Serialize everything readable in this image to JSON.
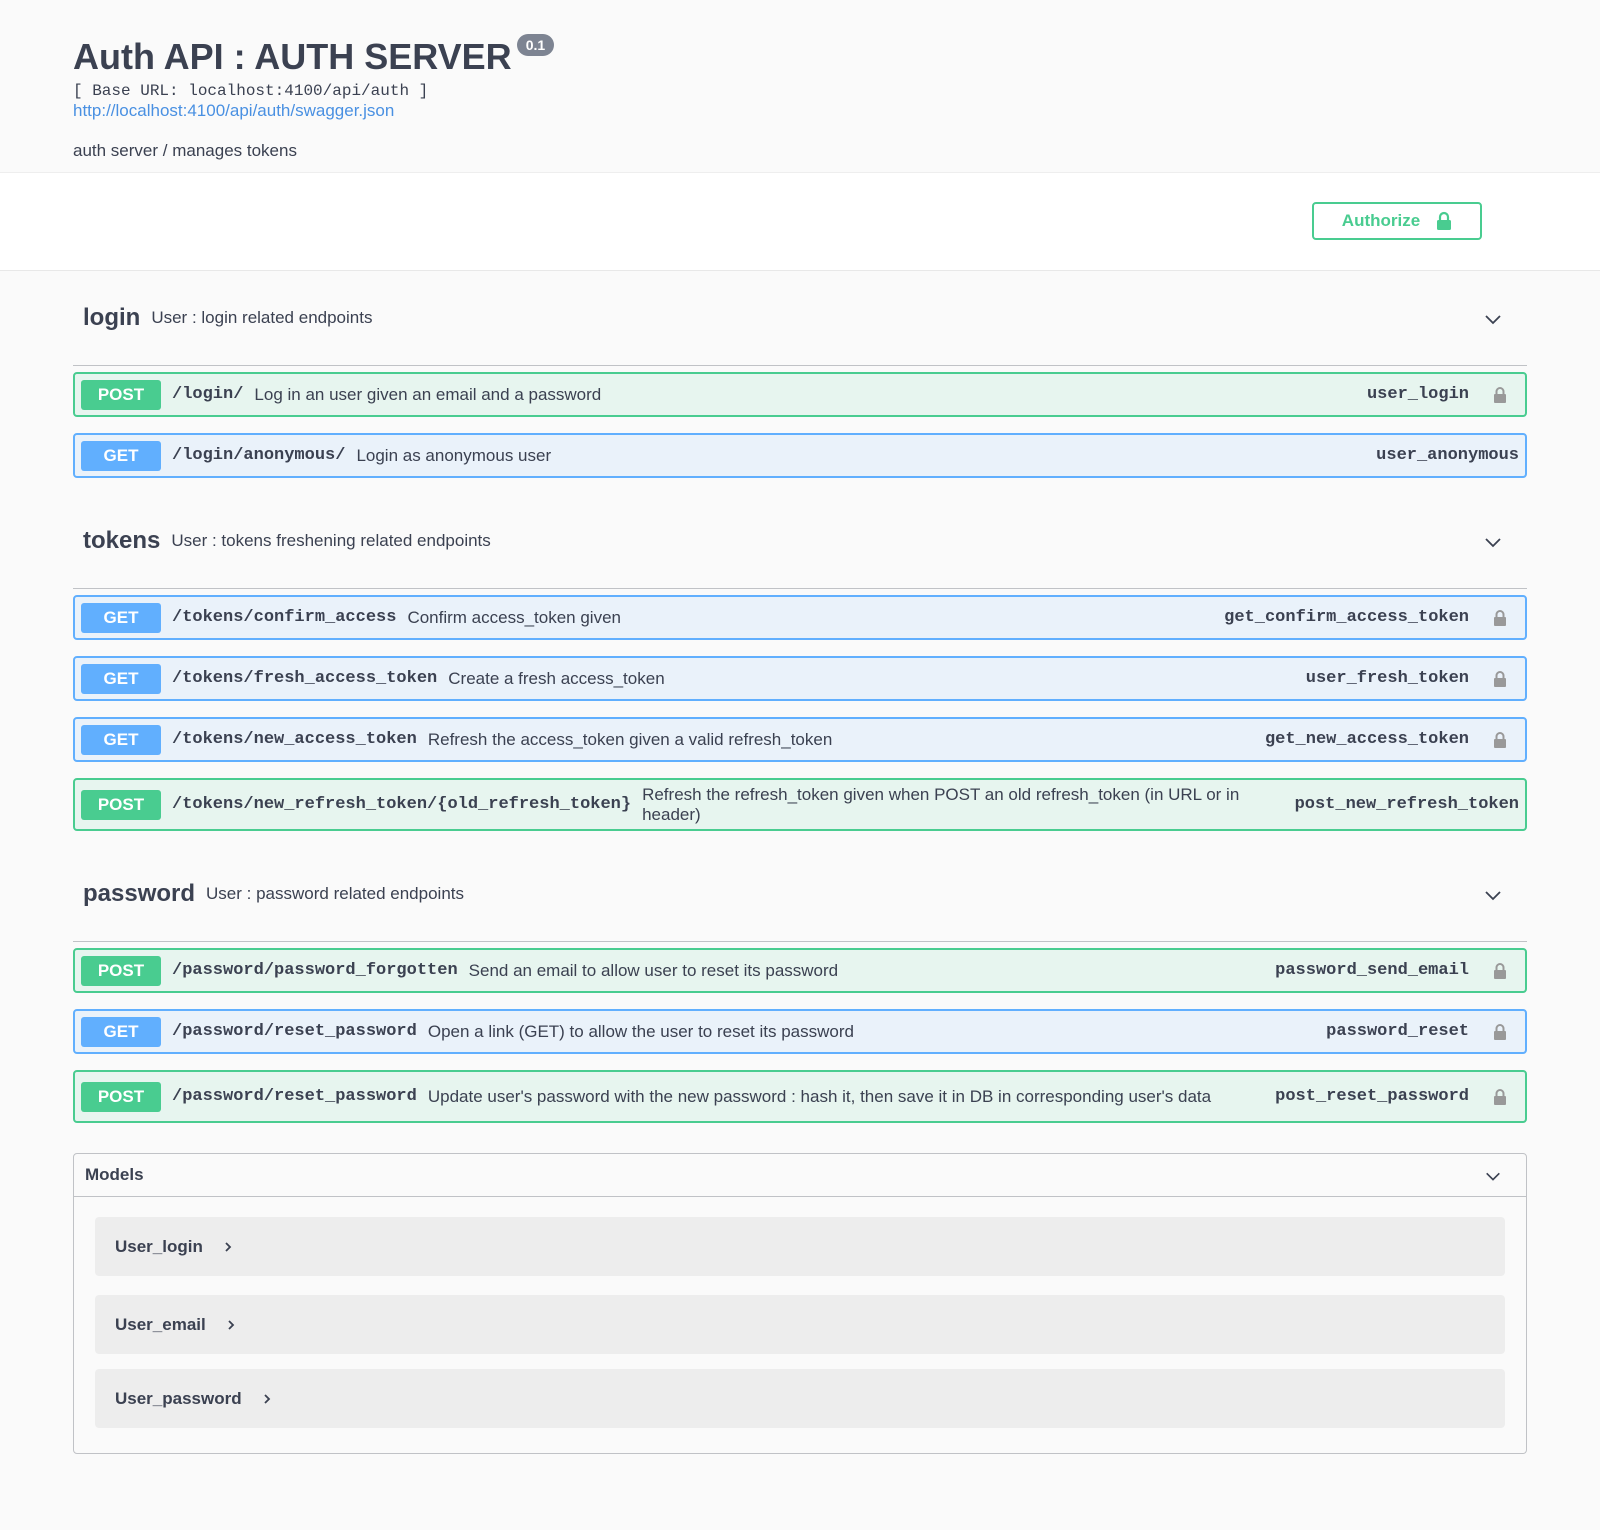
{
  "info": {
    "title": "Auth API : AUTH SERVER",
    "version": "0.1",
    "base_url": "[ Base URL: localhost:4100/api/auth ]",
    "spec_link": "http://localhost:4100/api/auth/swagger.json",
    "description": "auth server / manages tokens"
  },
  "authorize": {
    "label": "Authorize"
  },
  "tags": [
    {
      "name": "login",
      "description": "User : login related endpoints",
      "operations": [
        {
          "method": "POST",
          "path": "/login/",
          "summary": "Log in an user given an email and a password",
          "operation_id": "user_login",
          "locked": true
        },
        {
          "method": "GET",
          "path": "/login/anonymous/",
          "summary": "Login as anonymous user",
          "operation_id": "user_anonymous",
          "locked": false
        }
      ]
    },
    {
      "name": "tokens",
      "description": "User : tokens freshening related endpoints",
      "operations": [
        {
          "method": "GET",
          "path": "/tokens/confirm_access",
          "summary": "Confirm access_token given",
          "operation_id": "get_confirm_access_token",
          "locked": true
        },
        {
          "method": "GET",
          "path": "/tokens/fresh_access_token",
          "summary": "Create a fresh access_token",
          "operation_id": "user_fresh_token",
          "locked": true
        },
        {
          "method": "GET",
          "path": "/tokens/new_access_token",
          "summary": "Refresh the access_token given a valid refresh_token",
          "operation_id": "get_new_access_token",
          "locked": true
        },
        {
          "method": "POST",
          "path": "/tokens/new_refresh_token/{old_refresh_token}",
          "summary": "Refresh the refresh_token given when POST an old refresh_token (in URL or in header)",
          "operation_id": "post_new_refresh_token",
          "locked": false
        }
      ]
    },
    {
      "name": "password",
      "description": "User : password related endpoints",
      "operations": [
        {
          "method": "POST",
          "path": "/password/password_forgotten",
          "summary": "Send an email to allow user to reset its password",
          "operation_id": "password_send_email",
          "locked": true
        },
        {
          "method": "GET",
          "path": "/password/reset_password",
          "summary": "Open a link (GET) to allow the user to reset its password",
          "operation_id": "password_reset",
          "locked": true
        },
        {
          "method": "POST",
          "path": "/password/reset_password",
          "summary": "Update user's password with the new password : hash it, then save it in DB in corresponding user's data",
          "operation_id": "post_reset_password",
          "locked": true
        }
      ]
    }
  ],
  "models": {
    "title": "Models",
    "items": [
      "User_login",
      "User_email",
      "User_password"
    ]
  },
  "colors": {
    "post": "#49cc90",
    "get": "#61afe",
    "link": "#4990e2",
    "text": "#3b4151"
  },
  "icons": {
    "lock": "lock-icon",
    "chevron_down": "chevron-down-icon",
    "chevron_right": "chevron-right-icon"
  }
}
